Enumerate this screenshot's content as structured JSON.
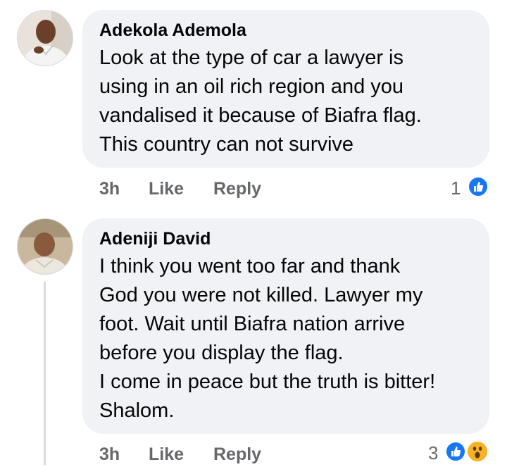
{
  "comments": [
    {
      "author": "Adekola Ademola",
      "text": "Look at the type of car a lawyer is\nusing in an oil rich region and you\nvandalised it because of Biafra flag.\nThis country can not survive",
      "time": "3h",
      "like_label": "Like",
      "reply_label": "Reply",
      "reaction_count": "1",
      "reactions": [
        "like-icon"
      ]
    },
    {
      "author": "Adeniji David",
      "text": "I think you went too far and thank\nGod you were not killed. Lawyer my\nfoot. Wait until Biafra nation arrive\nbefore you display the flag.\nI come in peace but the truth is bitter!\nShalom.",
      "time": "3h",
      "like_label": "Like",
      "reply_label": "Reply",
      "reaction_count": "3",
      "reactions": [
        "like-icon",
        "wow-icon"
      ]
    }
  ],
  "colors": {
    "bubble": "#f0f2f5",
    "secondary_text": "#65676b",
    "like_blue": "#1877f2",
    "wow_yellow": "#f7b125"
  }
}
